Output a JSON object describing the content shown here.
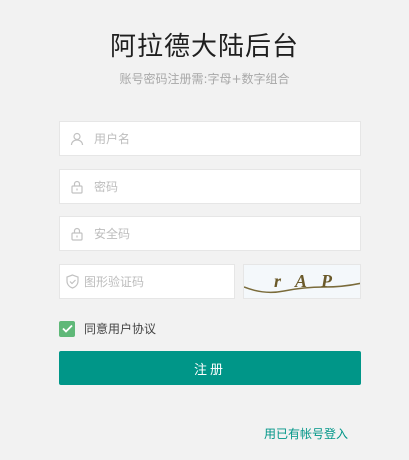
{
  "header": {
    "title": "阿拉德大陆后台",
    "subtitle": "账号密码注册需:字母+数字组合"
  },
  "form": {
    "username_placeholder": "用户名",
    "password_placeholder": "密码",
    "security_code_placeholder": "安全码",
    "captcha_placeholder": "图形验证码",
    "captcha_text": "rAP",
    "agree_label": "同意用户协议",
    "agree_checked": true,
    "submit_label": "注册",
    "login_link": "用已有帐号登入"
  },
  "colors": {
    "accent": "#009688",
    "checkbox": "#5fb878",
    "link": "#009688"
  },
  "icons": {
    "username": "user-icon",
    "password": "lock-icon",
    "security": "lock-icon",
    "captcha": "shield-icon"
  }
}
